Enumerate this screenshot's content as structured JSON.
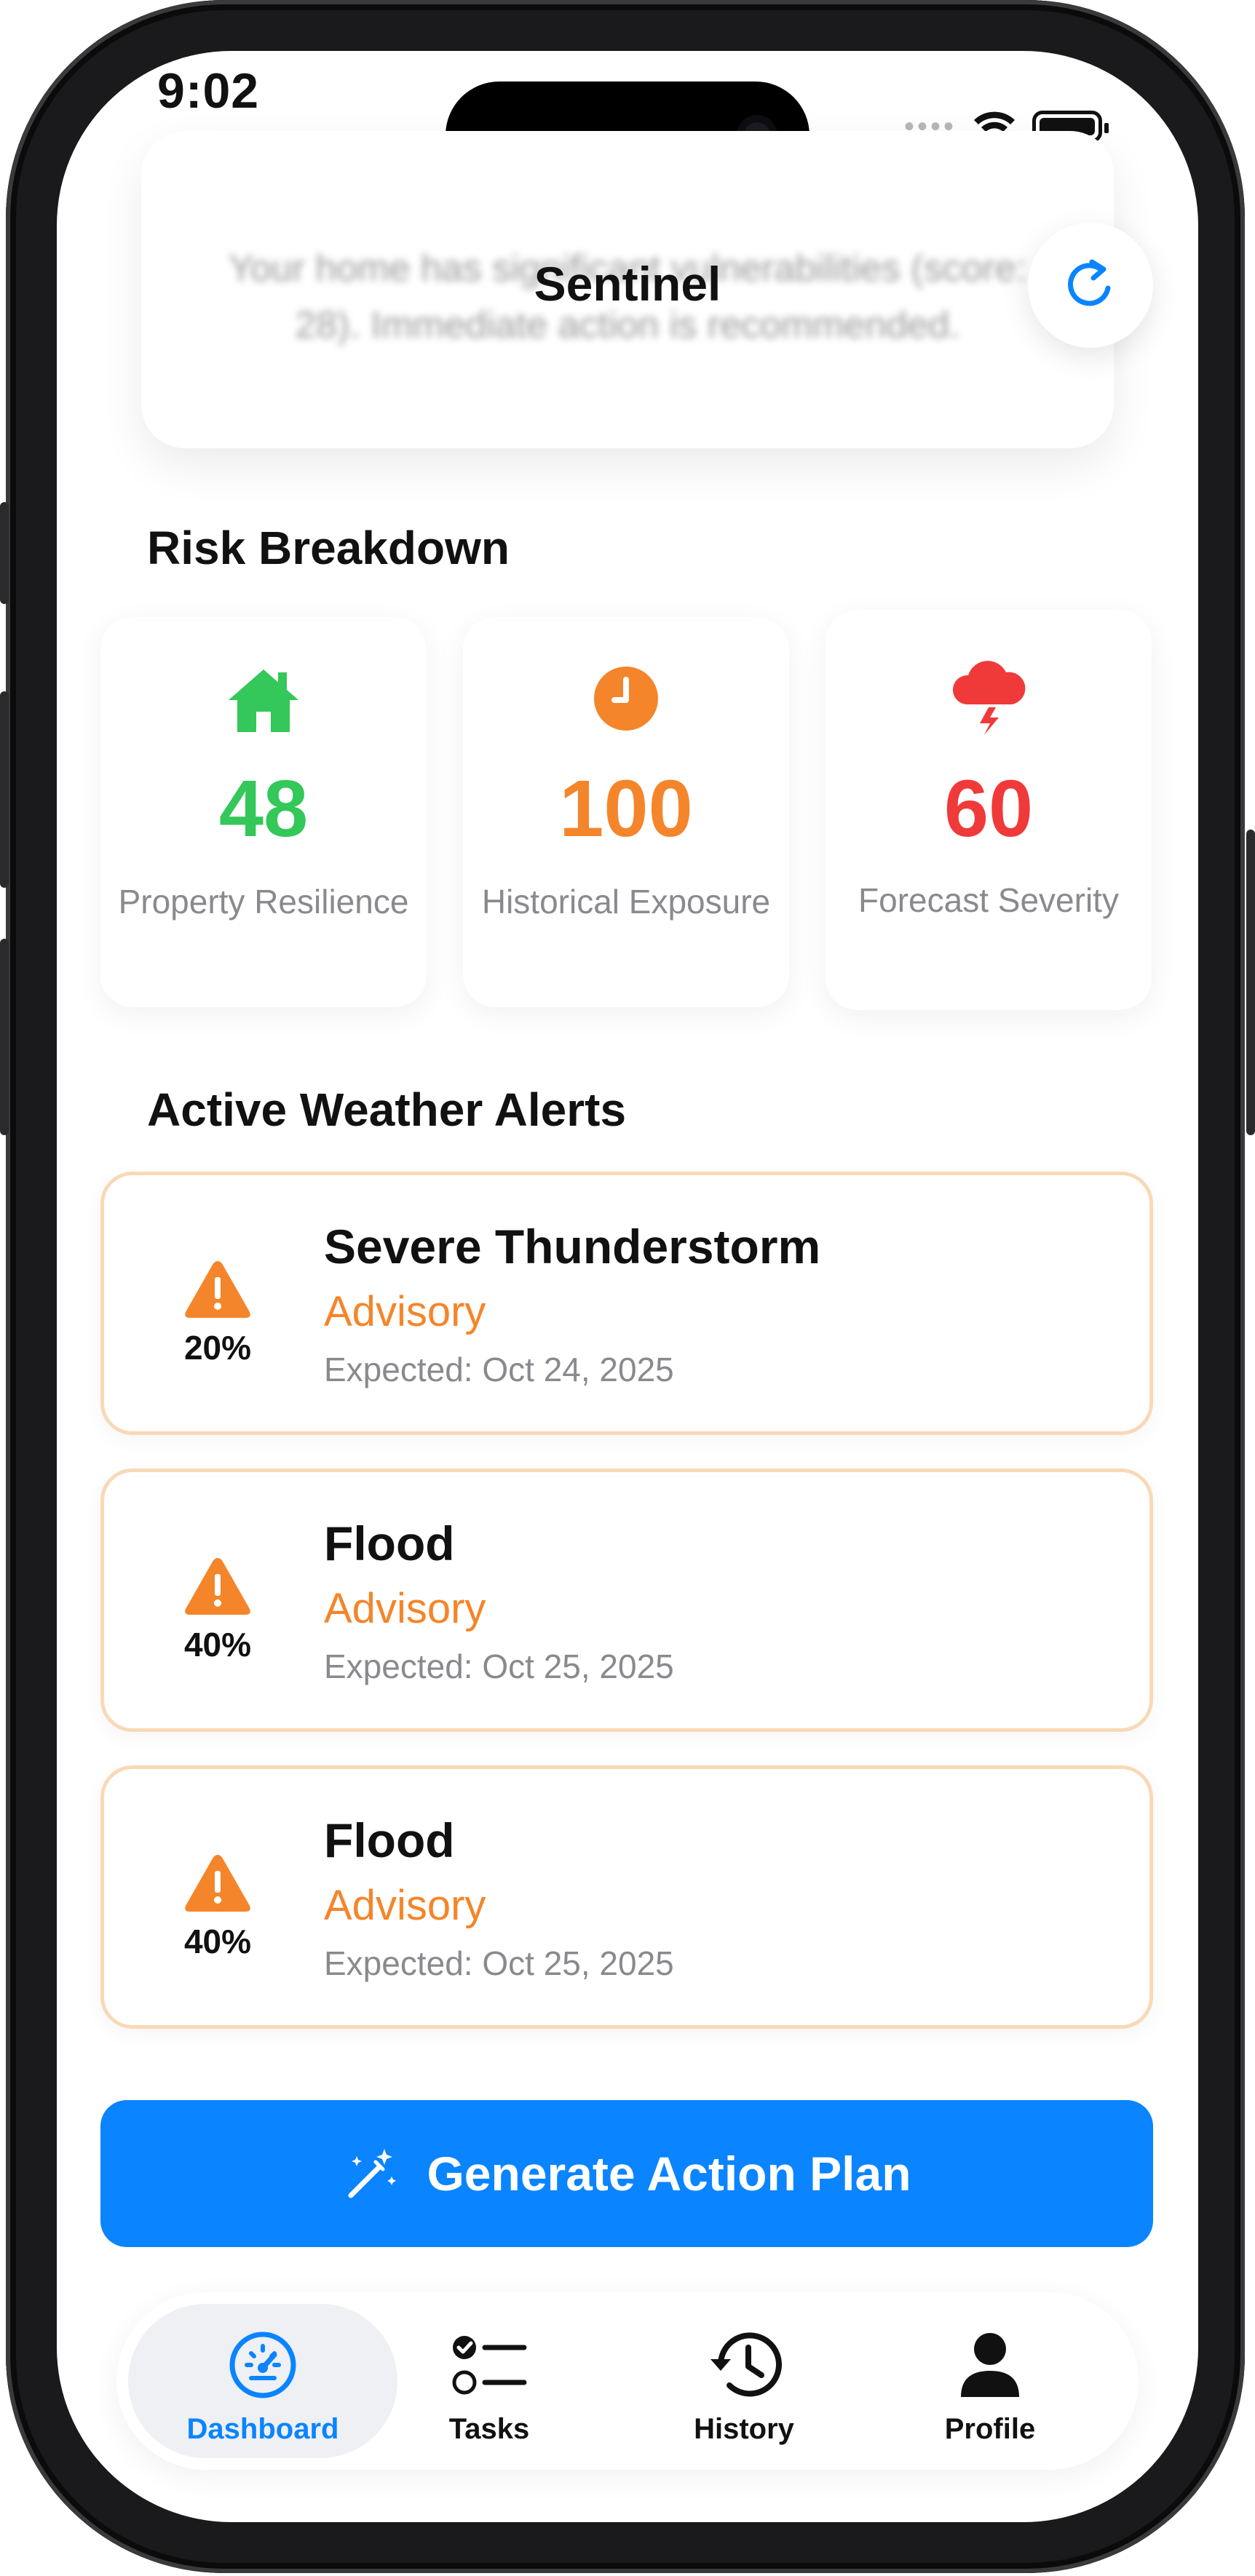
{
  "status_bar": {
    "time": "9:02"
  },
  "summary": {
    "text": "Your home has significant vulnerabilities (score: 28). Immediate action is recommended."
  },
  "app": {
    "title": "Sentinel"
  },
  "risk_breakdown": {
    "title": "Risk Breakdown",
    "cards": [
      {
        "icon": "house-icon",
        "value": "48",
        "label": "Property Resilience",
        "color": "#34c759"
      },
      {
        "icon": "clock-icon",
        "value": "100",
        "label": "Historical Exposure",
        "color": "#f5852a"
      },
      {
        "icon": "storm-cloud-icon",
        "value": "60",
        "label": "Forecast Severity",
        "color": "#f03a3a"
      }
    ]
  },
  "alerts": {
    "title": "Active Weather Alerts",
    "items": [
      {
        "probability": "20%",
        "title": "Severe Thunderstorm",
        "severity": "Advisory",
        "expected": "Expected: Oct 24, 2025"
      },
      {
        "probability": "40%",
        "title": "Flood",
        "severity": "Advisory",
        "expected": "Expected: Oct 25, 2025"
      },
      {
        "probability": "40%",
        "title": "Flood",
        "severity": "Advisory",
        "expected": "Expected: Oct 25, 2025"
      }
    ]
  },
  "cta": {
    "label": "Generate Action Plan",
    "icon": "magic-wand-icon"
  },
  "tabbar": {
    "tabs": [
      {
        "label": "Dashboard",
        "icon": "gauge-icon",
        "active": true
      },
      {
        "label": "Tasks",
        "icon": "checklist-icon",
        "active": false
      },
      {
        "label": "History",
        "icon": "history-icon",
        "active": false
      },
      {
        "label": "Profile",
        "icon": "person-icon",
        "active": false
      }
    ]
  },
  "colors": {
    "accent": "#0a84ff",
    "warning": "#f5852a",
    "success": "#34c759",
    "danger": "#f03a3a"
  }
}
